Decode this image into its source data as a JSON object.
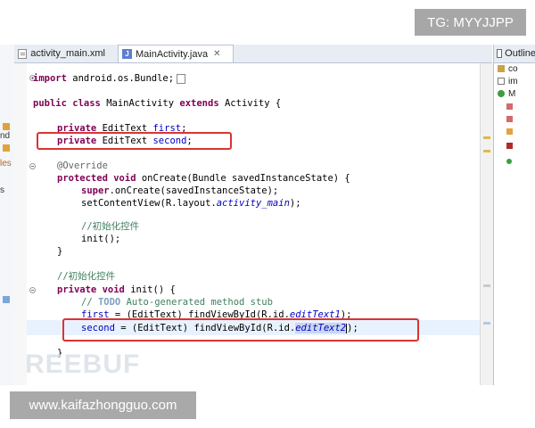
{
  "badges": {
    "top_right": "TG: MYYJJPP",
    "bottom_left": "www.kaifazhongguo.com"
  },
  "watermark": "REEBUF",
  "left_gutter": {
    "texts": [
      "nd",
      "les",
      "s"
    ]
  },
  "tabs": [
    {
      "label": "activity_main.xml",
      "icon": "xml-file-icon",
      "active": false
    },
    {
      "label": "MainActivity.java",
      "icon": "java-file-icon",
      "active": true,
      "close": "✕"
    }
  ],
  "outline": {
    "title": "Outline",
    "items": [
      {
        "label": "co",
        "icon": "package-icon"
      },
      {
        "label": "im",
        "icon": "imports-icon"
      },
      {
        "label": "M",
        "icon": "class-icon"
      }
    ]
  },
  "code": {
    "l1_kw": "import",
    "l1_rest": " android.os.Bundle;",
    "l2_kw1": "public",
    "l2_kw2": "class",
    "l2_name": " MainActivity ",
    "l2_kw3": "extends",
    "l2_rest": " Activity {",
    "l3_kw": "private",
    "l3_type": " EditText ",
    "l3_field": "first",
    "l3_end": ";",
    "l4_kw": "private",
    "l4_type": " EditText ",
    "l4_field": "second",
    "l4_end": ";",
    "l5_ann": "@Override",
    "l6_kw1": "protected",
    "l6_kw2": "void",
    "l6_rest": " onCreate(Bundle savedInstanceState) {",
    "l7_kw": "super",
    "l7_rest": ".onCreate(savedInstanceState);",
    "l8_pre": "setContentView(R.layout.",
    "l8_itl": "activity_main",
    "l8_post": ");",
    "l9_cmt": "//初始化控件",
    "l10": "init();",
    "l11": "}",
    "l12_cmt": "//初始化控件",
    "l13_kw1": "private",
    "l13_kw2": "void",
    "l13_rest": " init() {",
    "l14_cmt1": "// ",
    "l14_todo": "TODO",
    "l14_cmt2": " Auto-generated method stub",
    "l15_field": "first",
    "l15_mid": " = (EditText) findViewById(R.id.",
    "l15_itl": "editText1",
    "l15_post": ");",
    "l16_field": "second",
    "l16_mid": " = (EditText) findViewById(R.id.",
    "l16_itl": "editText2",
    "l16_post": ");",
    "l17": "}"
  }
}
